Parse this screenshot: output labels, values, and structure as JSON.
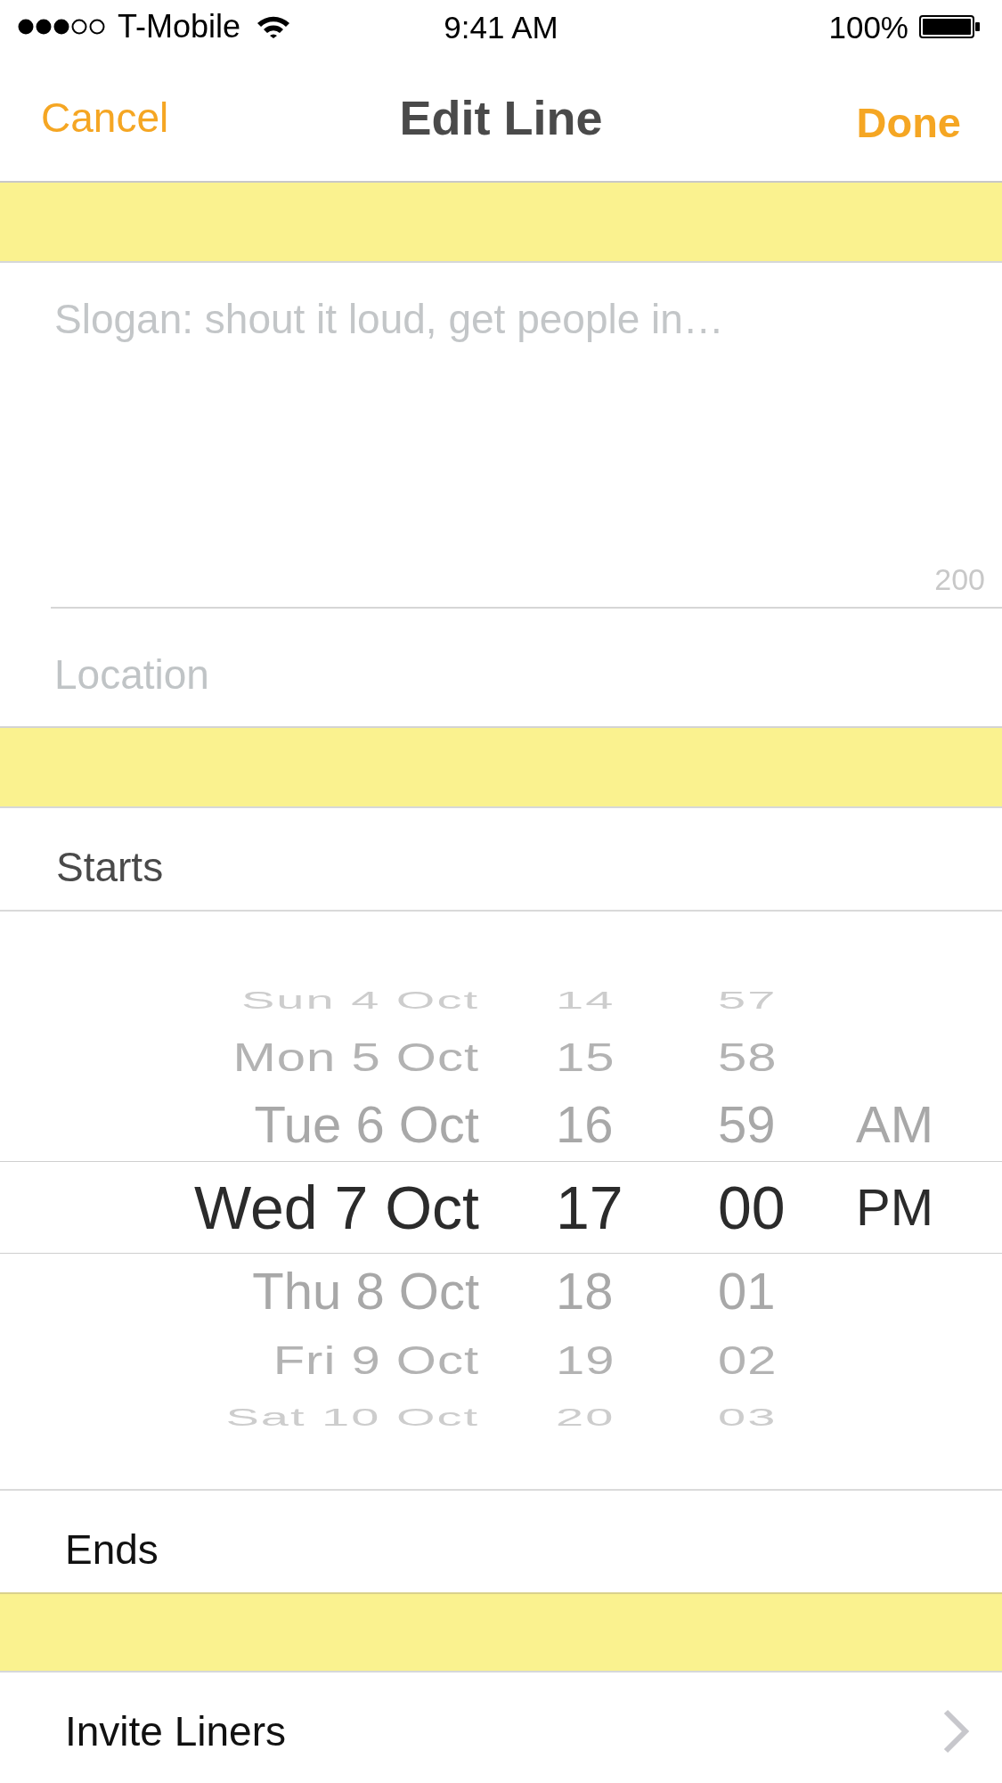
{
  "status_bar": {
    "carrier": "T-Mobile",
    "time": "9:41 AM",
    "battery": "100%"
  },
  "nav_bar": {
    "cancel": "Cancel",
    "title": "Edit Line",
    "done": "Done"
  },
  "slogan": {
    "placeholder": "Slogan: shout it loud, get people in…",
    "counter": "200"
  },
  "location": {
    "placeholder": "Location"
  },
  "starts": {
    "label": "Starts",
    "expanded": true,
    "picker": {
      "columns": [
        {
          "kind": "date",
          "items": [
            {
              "label": "Sun 4 Oct",
              "selected": false
            },
            {
              "label": "Mon 5 Oct",
              "selected": false
            },
            {
              "label": "Tue 6 Oct",
              "selected": false
            },
            {
              "label": "Wed 7 Oct",
              "selected": true
            },
            {
              "label": "Thu 8 Oct",
              "selected": false
            },
            {
              "label": "Fri 9 Oct",
              "selected": false
            },
            {
              "label": "Sat 10 Oct",
              "selected": false
            }
          ]
        },
        {
          "kind": "hour",
          "items": [
            {
              "label": "14",
              "selected": false
            },
            {
              "label": "15",
              "selected": false
            },
            {
              "label": "16",
              "selected": false
            },
            {
              "label": "17",
              "selected": true
            },
            {
              "label": "18",
              "selected": false
            },
            {
              "label": "19",
              "selected": false
            },
            {
              "label": "20",
              "selected": false
            }
          ]
        },
        {
          "kind": "minute",
          "items": [
            {
              "label": "57",
              "selected": false
            },
            {
              "label": "58",
              "selected": false
            },
            {
              "label": "59",
              "selected": false
            },
            {
              "label": "00",
              "selected": true
            },
            {
              "label": "01",
              "selected": false
            },
            {
              "label": "02",
              "selected": false
            },
            {
              "label": "03",
              "selected": false
            }
          ]
        },
        {
          "kind": "meridiem",
          "items": [
            {
              "label": "AM",
              "selected": false
            },
            {
              "label": "PM",
              "selected": true
            }
          ]
        }
      ]
    }
  },
  "ends": {
    "label": "Ends",
    "expanded": false
  },
  "invite": {
    "label": "Invite Liners"
  }
}
